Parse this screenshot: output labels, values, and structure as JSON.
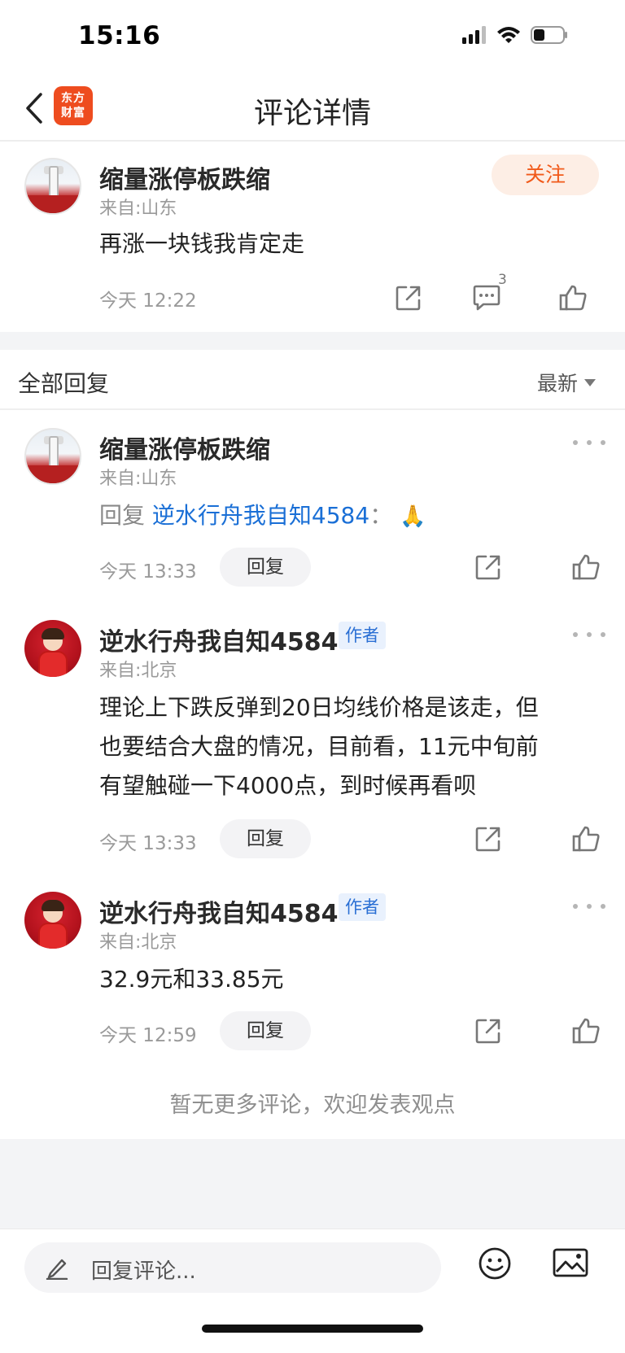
{
  "status_bar": {
    "time": "15:16"
  },
  "header": {
    "title": "评论详情",
    "logo_line1": "东方",
    "logo_line2": "财富"
  },
  "main_comment": {
    "user_name": "缩量涨停板跌缩",
    "from": "来自:山东",
    "follow_label": "关注",
    "text": "再涨一块钱我肯定走",
    "time": "今天 12:22",
    "comment_count": "3"
  },
  "replies_section": {
    "title": "全部回复",
    "sort_label": "最新"
  },
  "replies": [
    {
      "user_name": "缩量涨停板跌缩",
      "from": "来自:山东",
      "reply_prefix": "回复",
      "reply_target": "逆水行舟我自知4584",
      "reply_sep": "：",
      "emoji": "🙏",
      "time": "今天 13:33",
      "reply_label": "回复"
    },
    {
      "user_name": "逆水行舟我自知4584",
      "author_tag": "作者",
      "from": "来自:北京",
      "text_line1": "理论上下跌反弹到20日均线价格是该走，但",
      "text_line2": "也要结合大盘的情况，目前看，11元中旬前",
      "text_line3": "有望触碰一下4000点，到时候再看呗",
      "time": "今天 13:33",
      "reply_label": "回复"
    },
    {
      "user_name": "逆水行舟我自知4584",
      "author_tag": "作者",
      "from": "来自:北京",
      "text": "32.9元和33.85元",
      "time": "今天 12:59",
      "reply_label": "回复"
    }
  ],
  "end_hint": "暂无更多评论，欢迎发表观点",
  "bottom_bar": {
    "placeholder": "回复评论..."
  },
  "colors": {
    "accent_orange": "#f15a1a",
    "link_blue": "#1a6fd6",
    "brand_red": "#ee4c1f"
  }
}
